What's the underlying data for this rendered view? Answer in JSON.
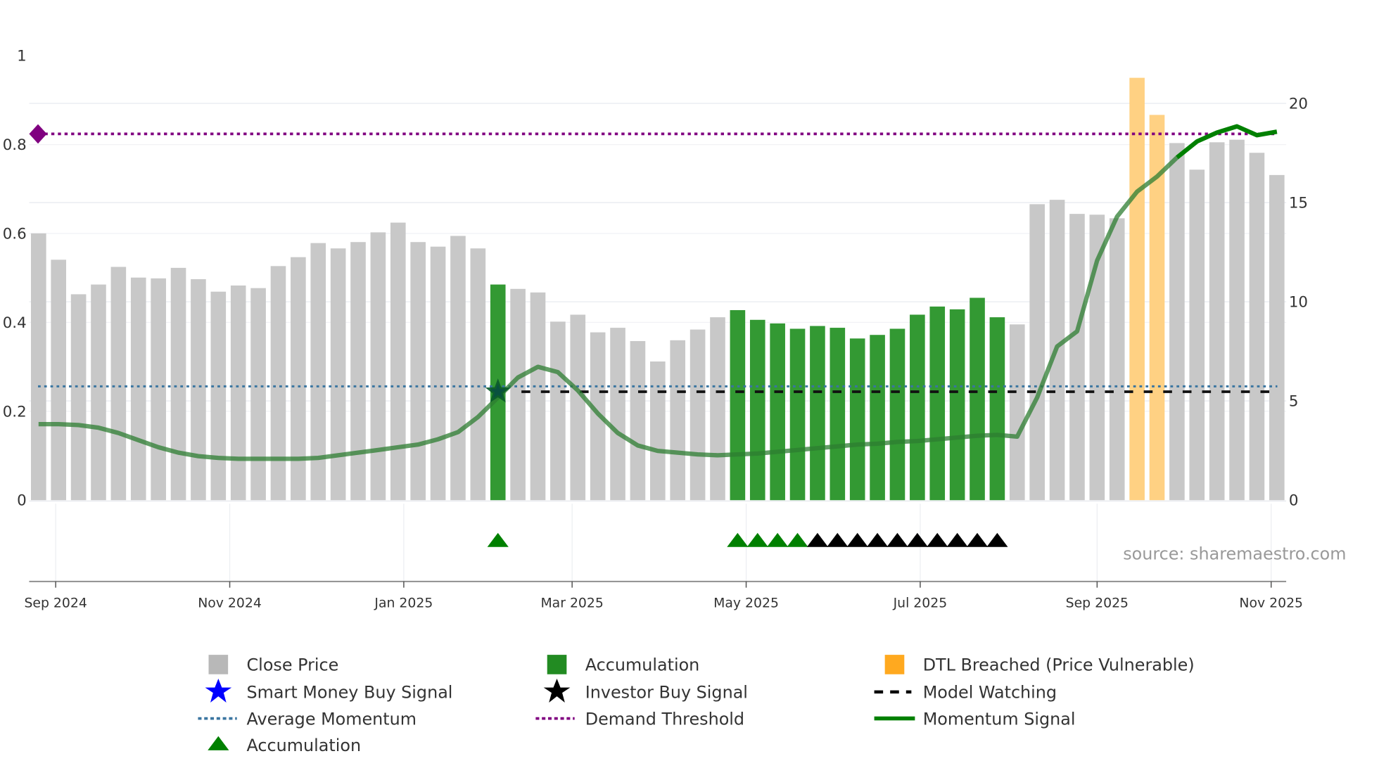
{
  "chart_data": {
    "type": "bar",
    "title": "",
    "dates": [
      "2024-08-26",
      "2024-09-02",
      "2024-09-09",
      "2024-09-16",
      "2024-09-23",
      "2024-09-30",
      "2024-10-07",
      "2024-10-14",
      "2024-10-21",
      "2024-10-28",
      "2024-11-04",
      "2024-11-11",
      "2024-11-18",
      "2024-11-25",
      "2024-12-02",
      "2024-12-09",
      "2024-12-16",
      "2024-12-23",
      "2024-12-30",
      "2025-01-06",
      "2025-01-13",
      "2025-01-20",
      "2025-01-27",
      "2025-02-03",
      "2025-02-10",
      "2025-02-17",
      "2025-02-24",
      "2025-03-03",
      "2025-03-10",
      "2025-03-17",
      "2025-03-24",
      "2025-03-31",
      "2025-04-07",
      "2025-04-14",
      "2025-04-21",
      "2025-04-28",
      "2025-05-05",
      "2025-05-12",
      "2025-05-19",
      "2025-05-26",
      "2025-06-02",
      "2025-06-09",
      "2025-06-16",
      "2025-06-23",
      "2025-06-30",
      "2025-07-07",
      "2025-07-14",
      "2025-07-21",
      "2025-07-28",
      "2025-08-04",
      "2025-08-11",
      "2025-08-18",
      "2025-08-25",
      "2025-09-01",
      "2025-09-08",
      "2025-09-15",
      "2025-09-22",
      "2025-09-29",
      "2025-10-06",
      "2025-10-13",
      "2025-10-20",
      "2025-10-27",
      "2025-11-03"
    ],
    "close_price": [
      13.45,
      12.12,
      10.38,
      10.87,
      11.76,
      11.22,
      11.18,
      11.71,
      11.14,
      10.51,
      10.82,
      10.69,
      11.8,
      12.25,
      12.96,
      12.69,
      13.01,
      13.5,
      13.99,
      13.01,
      12.78,
      13.32,
      12.69,
      10.87,
      10.65,
      10.47,
      9.0,
      9.35,
      8.46,
      8.69,
      8.02,
      6.99,
      8.06,
      8.6,
      9.22,
      9.58,
      9.09,
      8.91,
      8.64,
      8.78,
      8.69,
      8.15,
      8.33,
      8.64,
      9.35,
      9.76,
      9.62,
      10.2,
      9.22,
      8.86,
      14.92,
      15.14,
      14.43,
      14.39,
      14.21,
      21.29,
      19.42,
      18.0,
      16.66,
      18.04,
      18.17,
      17.51,
      16.39
    ],
    "momentum_signal": [
      0.171,
      0.171,
      0.169,
      0.163,
      0.151,
      0.135,
      0.119,
      0.107,
      0.099,
      0.095,
      0.093,
      0.093,
      0.093,
      0.093,
      0.095,
      0.101,
      0.107,
      0.113,
      0.119,
      0.125,
      0.137,
      0.153,
      0.187,
      0.231,
      0.276,
      0.3,
      0.288,
      0.247,
      0.195,
      0.151,
      0.123,
      0.111,
      0.107,
      0.103,
      0.101,
      0.103,
      0.105,
      0.109,
      0.113,
      0.117,
      0.121,
      0.125,
      0.127,
      0.131,
      0.133,
      0.137,
      0.141,
      0.145,
      0.147,
      0.143,
      0.231,
      0.346,
      0.38,
      0.539,
      0.638,
      0.694,
      0.728,
      0.771,
      0.807,
      0.827,
      0.841,
      0.821,
      0.829
    ],
    "accumulation_bars": [
      23,
      35,
      36,
      37,
      38,
      39,
      40,
      41,
      42,
      43,
      44,
      45,
      46,
      47,
      48
    ],
    "dtl_breached_bars": [
      55,
      56
    ],
    "accumulation_triangles": [
      23,
      35,
      36,
      37,
      38
    ],
    "investor_triangles": [
      39,
      40,
      41,
      42,
      43,
      44,
      45,
      46,
      47,
      48
    ],
    "investor_buy_signal": {
      "index": 23,
      "value": 0.25
    },
    "smart_money_buy_signal": {
      "index": 23,
      "value": 0.25
    },
    "model_watching": {
      "from_index": 24,
      "to_index": 62,
      "value": 0.25
    },
    "average_momentum": 0.256,
    "demand_threshold": 0.824,
    "y_left": {
      "range": [
        0,
        1
      ],
      "ticks": [
        "0",
        "0.2",
        "0.4",
        "0.6",
        "0.8",
        "1"
      ],
      "values": [
        0,
        0.2,
        0.4,
        0.6,
        0.8,
        1
      ]
    },
    "y_right": {
      "range": [
        0,
        22.4
      ],
      "ticks": [
        "0",
        "5",
        "10",
        "15",
        "20"
      ],
      "values": [
        0,
        5,
        10,
        15,
        20
      ]
    },
    "x_ticks": [
      {
        "label": "Sep 2024",
        "date": "2024-09-01"
      },
      {
        "label": "Nov 2024",
        "date": "2024-11-01"
      },
      {
        "label": "Jan 2025",
        "date": "2025-01-01"
      },
      {
        "label": "Mar 2025",
        "date": "2025-03-01"
      },
      {
        "label": "May 2025",
        "date": "2025-05-01"
      },
      {
        "label": "Jul 2025",
        "date": "2025-07-01"
      },
      {
        "label": "Sep 2025",
        "date": "2025-09-01"
      },
      {
        "label": "Nov 2025",
        "date": "2025-11-01"
      }
    ],
    "grid": true,
    "legend_placement": "bottom",
    "annotation": "source: sharemaestro.com"
  },
  "legend": {
    "close_price": "Close Price",
    "accumulation_bar": "Accumulation",
    "dtl": "DTL Breached (Price Vulnerable)",
    "smart_money": "Smart Money Buy Signal",
    "investor": "Investor Buy Signal",
    "model_watching": "Model Watching",
    "avg_momentum": "Average Momentum",
    "demand_threshold": "Demand Threshold",
    "momentum_signal": "Momentum Signal",
    "accumulation_marker": "Accumulation"
  },
  "colors": {
    "close": "#c8c8c8",
    "accumulation": "#339933",
    "dtl": "#ffd183",
    "momentum": "#008000",
    "avg": "#3a75a0",
    "threshold": "#800080",
    "smart": "#0000ff",
    "black": "#000000"
  }
}
